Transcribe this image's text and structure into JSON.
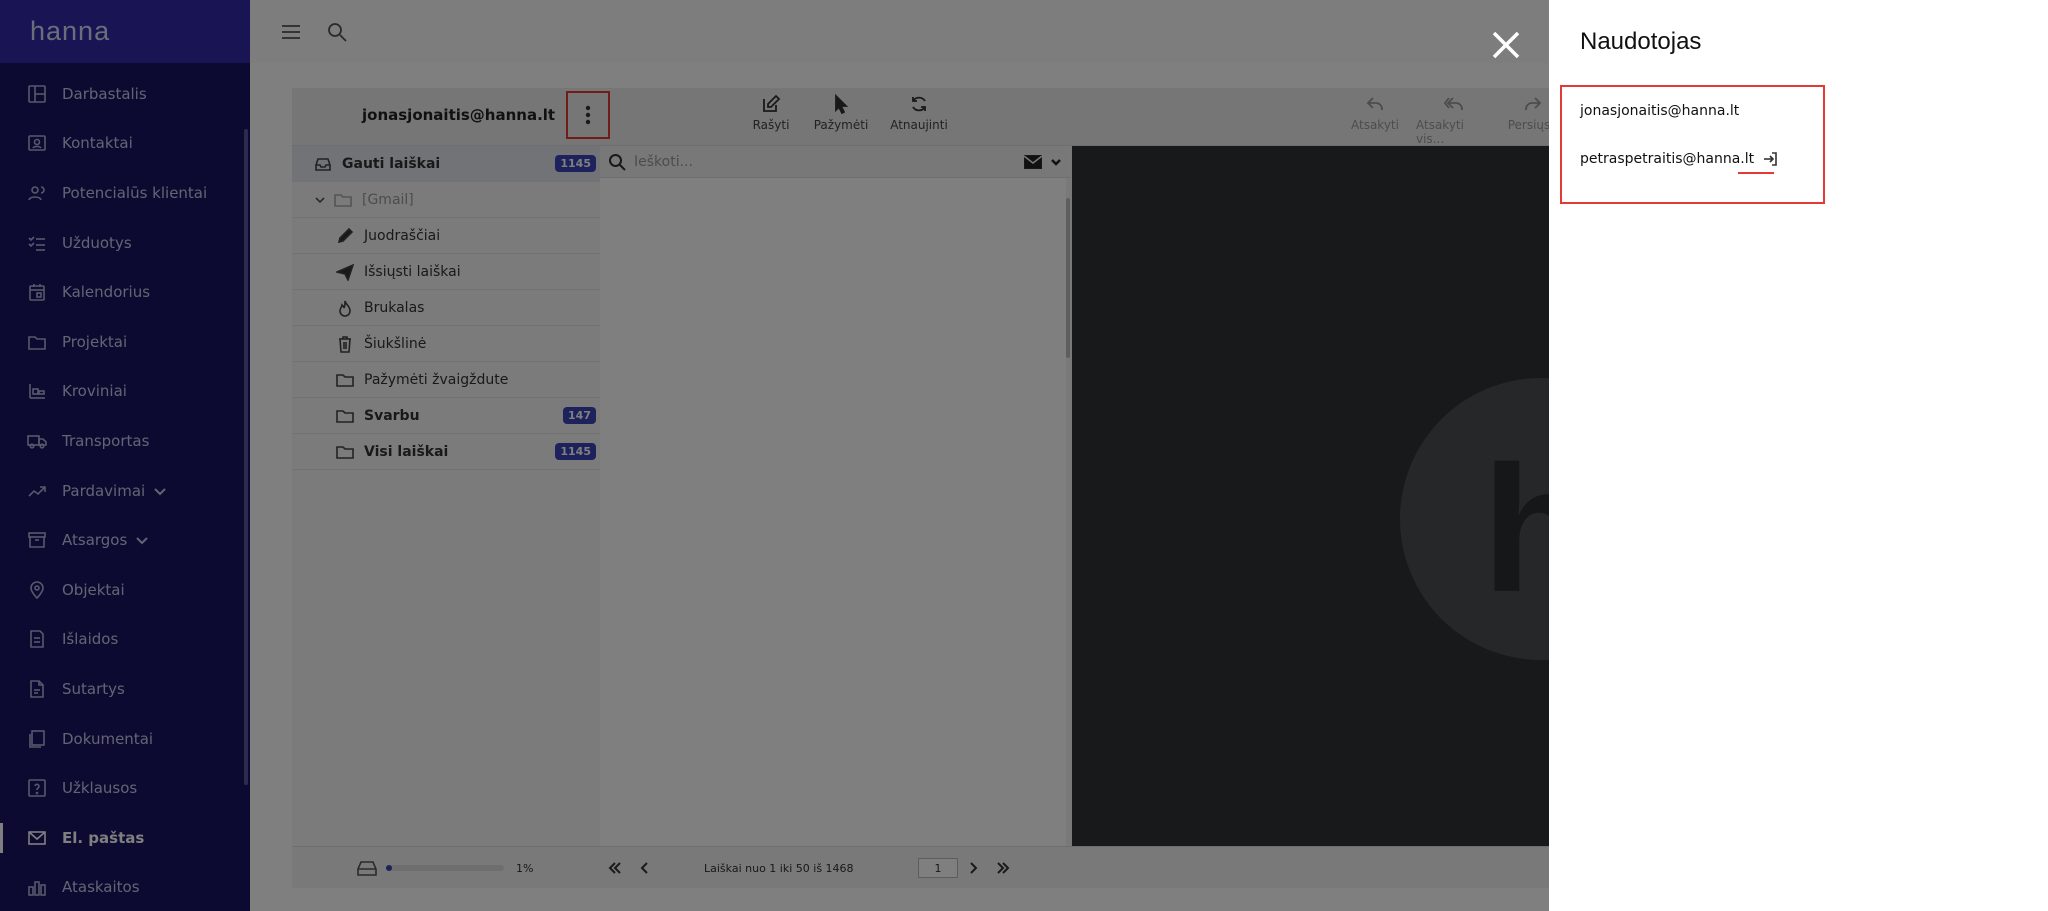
{
  "brand": {
    "name": "hanna"
  },
  "sidebar": {
    "items": [
      {
        "label": "Darbastalis",
        "icon": "dashboard-icon"
      },
      {
        "label": "Kontaktai",
        "icon": "contacts-icon"
      },
      {
        "label": "Potencialūs klientai",
        "icon": "leads-icon"
      },
      {
        "label": "Užduotys",
        "icon": "tasks-icon"
      },
      {
        "label": "Kalendorius",
        "icon": "calendar-icon"
      },
      {
        "label": "Projektai",
        "icon": "folder-icon"
      },
      {
        "label": "Kroviniai",
        "icon": "cargo-icon"
      },
      {
        "label": "Transportas",
        "icon": "truck-icon"
      },
      {
        "label": "Pardavimai",
        "icon": "sales-icon"
      },
      {
        "label": "Atsargos",
        "icon": "inventory-icon"
      },
      {
        "label": "Objektai",
        "icon": "location-icon"
      },
      {
        "label": "Išlaidos",
        "icon": "expenses-icon"
      },
      {
        "label": "Sutartys",
        "icon": "contract-icon"
      },
      {
        "label": "Dokumentai",
        "icon": "documents-icon"
      },
      {
        "label": "Užklausos",
        "icon": "inquiry-icon"
      },
      {
        "label": "El. paštas",
        "icon": "mail-icon"
      },
      {
        "label": "Ataskaitos",
        "icon": "reports-icon"
      }
    ]
  },
  "mail": {
    "account": "jonasjonaitis@hanna.lt",
    "toolbar": {
      "compose": "Rašyti",
      "select": "Pažymėti",
      "refresh": "Atnaujinti"
    },
    "reader_tools": {
      "reply": "Atsakyti",
      "reply_all": "Atsakyti vis...",
      "forward": "Persiųsti"
    },
    "folders": [
      {
        "label": "Gauti laiškai",
        "badge": "1145"
      },
      {
        "label": "[Gmail]"
      },
      {
        "label": "Juodraščiai"
      },
      {
        "label": "Išsiųsti laiškai"
      },
      {
        "label": "Brukalas"
      },
      {
        "label": "Šiukšlinė"
      },
      {
        "label": "Pažymėti žvaigždute"
      },
      {
        "label": "Svarbu",
        "badge": "147"
      },
      {
        "label": "Visi laiškai",
        "badge": "1145"
      }
    ],
    "search_placeholder": "Ieškoti...",
    "quota_percent": "1%",
    "quota_fraction": 0.01,
    "pager_info": "Laiškai nuo 1 iki 50 iš 1468",
    "page_number": "1"
  },
  "panel": {
    "title": "Naudotojas",
    "accounts": [
      {
        "email": "jonasjonaitis@hanna.lt"
      },
      {
        "email": "petraspetraitis@hanna.lt"
      }
    ]
  }
}
